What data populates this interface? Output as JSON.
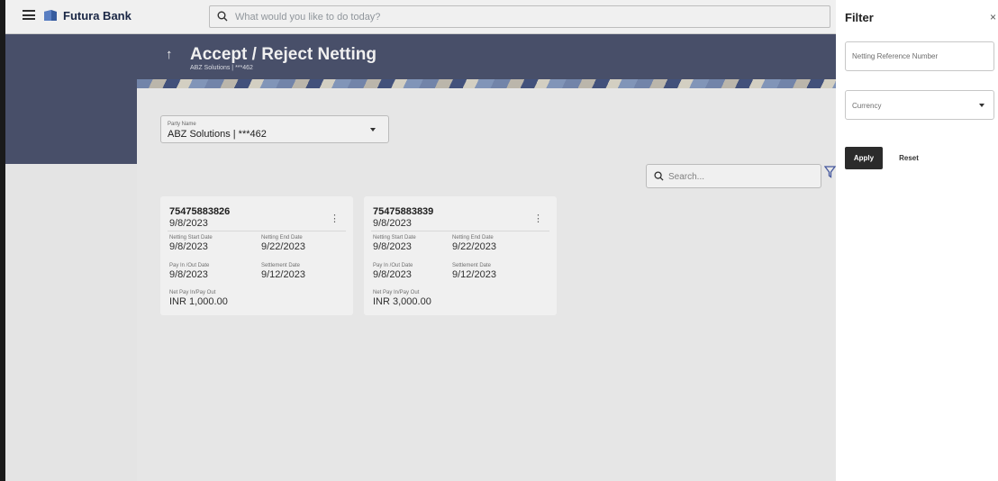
{
  "topbar": {
    "brand": "Futura Bank",
    "search_placeholder": "What would you like to do today?"
  },
  "header": {
    "title": "Accept / Reject Netting",
    "subtitle": "ABZ Solutions | ***462"
  },
  "party": {
    "label": "Party Name",
    "value": "ABZ Solutions | ***462"
  },
  "list_search": {
    "placeholder": "Search..."
  },
  "cards": [
    {
      "ref": "75475883826",
      "date": "9/8/2023",
      "netting_start_label": "Netting Start Date",
      "netting_start": "9/8/2023",
      "netting_end_label": "Netting End Date",
      "netting_end": "9/22/2023",
      "pay_date_label": "Pay In /Out Date",
      "pay_date": "9/8/2023",
      "settlement_label": "Settlement Date",
      "settlement": "9/12/2023",
      "net_label": "Net Pay In/Pay Out",
      "net": "INR 1,000.00"
    },
    {
      "ref": "75475883839",
      "date": "9/8/2023",
      "netting_start_label": "Netting Start Date",
      "netting_start": "9/8/2023",
      "netting_end_label": "Netting End Date",
      "netting_end": "9/22/2023",
      "pay_date_label": "Pay In /Out Date",
      "pay_date": "9/8/2023",
      "settlement_label": "Settlement Date",
      "settlement": "9/12/2023",
      "net_label": "Net Pay In/Pay Out",
      "net": "INR 3,000.00"
    }
  ],
  "filter": {
    "title": "Filter",
    "close": "×",
    "reference_placeholder": "Netting Reference Number",
    "currency_value": "Currency",
    "apply_label": "Apply",
    "reset_label": "Reset"
  },
  "icons": {
    "menu": "hamburger-icon",
    "logo": "bank-logo-icon",
    "search": "search-icon",
    "back": "up-arrow-icon",
    "more": "kebab-icon",
    "filter": "filter-icon",
    "close": "close-icon"
  },
  "colors": {
    "header_bg": "#4d5470",
    "brand_text": "#1c2a4a",
    "apply_bg": "#2b2b2b"
  }
}
